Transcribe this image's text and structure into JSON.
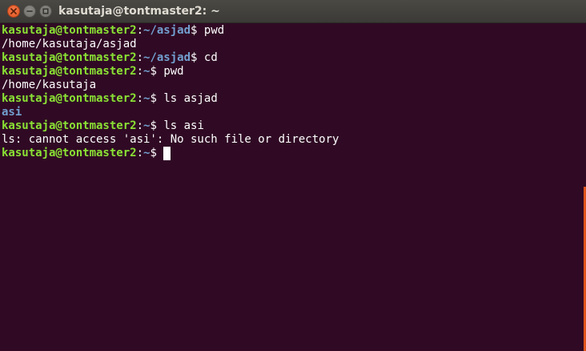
{
  "window": {
    "title": "kasutaja@tontmaster2: ~",
    "accent_color": "#e0541c",
    "background_color": "#300a24"
  },
  "controls": {
    "close_icon": "close-icon",
    "minimize_icon": "minimize-icon",
    "maximize_icon": "maximize-icon"
  },
  "terminal": {
    "lines": [
      {
        "user": "kasutaja@tontmaster2",
        "colon": ":",
        "path": "~/asjad",
        "suffix": "$ ",
        "command": "pwd"
      },
      {
        "output": "/home/kasutaja/asjad"
      },
      {
        "user": "kasutaja@tontmaster2",
        "colon": ":",
        "path": "~/asjad",
        "suffix": "$ ",
        "command": "cd"
      },
      {
        "user": "kasutaja@tontmaster2",
        "colon": ":",
        "path": "~",
        "suffix": "$ ",
        "command": "pwd"
      },
      {
        "output": "/home/kasutaja"
      },
      {
        "user": "kasutaja@tontmaster2",
        "colon": ":",
        "path": "~",
        "suffix": "$ ",
        "command": "ls asjad"
      },
      {
        "dir_output": "asi"
      },
      {
        "user": "kasutaja@tontmaster2",
        "colon": ":",
        "path": "~",
        "suffix": "$ ",
        "command": "ls asi"
      },
      {
        "output": "ls: cannot access 'asi': No such file or directory"
      },
      {
        "user": "kasutaja@tontmaster2",
        "colon": ":",
        "path": "~",
        "suffix": "$ ",
        "command": ""
      }
    ]
  }
}
